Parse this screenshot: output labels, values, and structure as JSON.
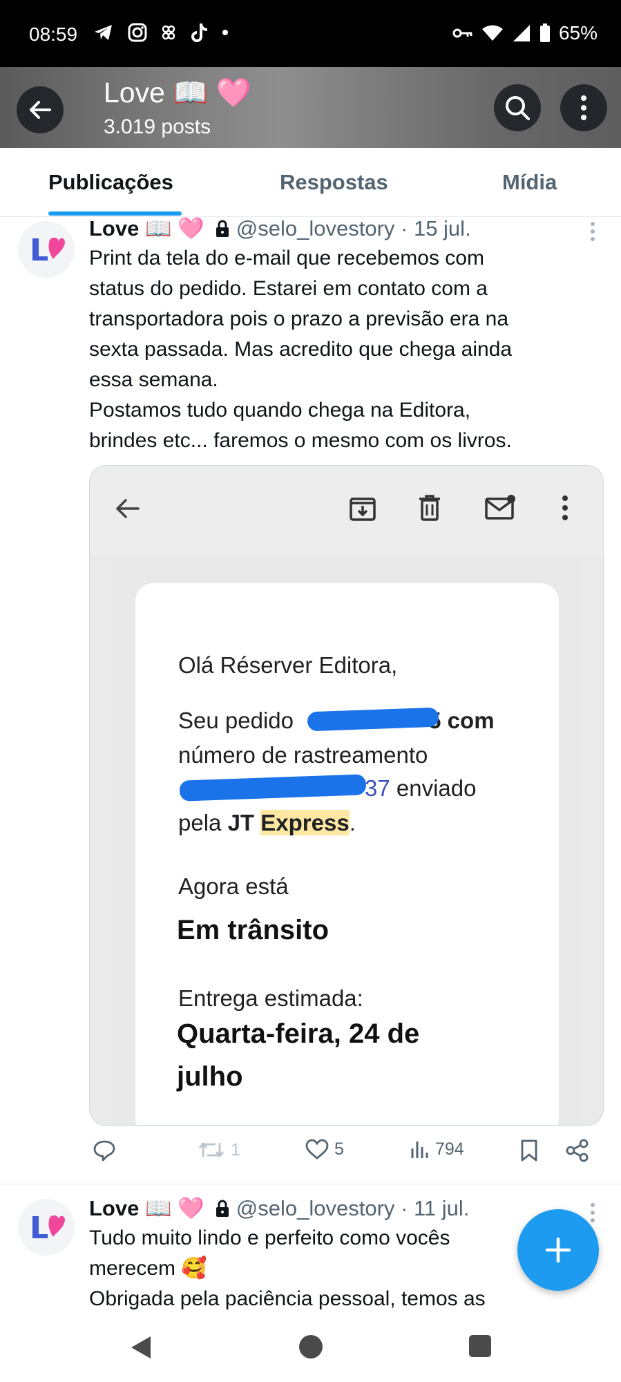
{
  "status_bar": {
    "time": "08:59",
    "battery": "65%",
    "icons_left": [
      "telegram-icon",
      "instagram-icon",
      "link-icon",
      "tiktok-icon",
      "dot-icon"
    ],
    "icons_right": [
      "key-icon",
      "wifi-icon",
      "signal-icon",
      "battery-icon"
    ]
  },
  "header": {
    "title": "Love 📖 🩷",
    "posts_count": "3.019 posts"
  },
  "tabs": [
    {
      "label": "Publicações",
      "active": true
    },
    {
      "label": "Respostas",
      "active": false
    },
    {
      "label": "Mídia",
      "active": false
    }
  ],
  "posts": [
    {
      "author": "Love 📖 🩷",
      "handle_date": "@selo_lovestory · 15 jul.",
      "text_lines": [
        "Print da tela do e-mail que recebemos com",
        "status do pedido. Estarei em contato com a",
        "transportadora pois o prazo a previsão era na",
        "sexta passada. Mas acredito que chega ainda",
        "essa semana.",
        "Postamos tudo quando chega na Editora,",
        "brindes etc... faremos o mesmo com os livros."
      ],
      "media": {
        "greeting": "Olá Réserver Editora,",
        "line1_a": "Seu pedido",
        "line1_b": "5 com",
        "line2": "número de rastreamento",
        "line3_a": "37",
        "line3_b": "enviado",
        "line4_a": "pela",
        "line4_b": "JT",
        "line4_c": "Express",
        "line4_d": ".",
        "status_label": "Agora está",
        "status_value": "Em trânsito",
        "delivery_label": "Entrega estimada:",
        "delivery_line1": "Quarta-feira, 24 de",
        "delivery_line2": "julho"
      },
      "actions": {
        "retweets": "1",
        "likes": "5",
        "views": "794"
      }
    },
    {
      "author": "Love 📖 🩷",
      "handle_date": "@selo_lovestory · 11 jul.",
      "text_lines": [
        "Tudo muito lindo e perfeito como vocês",
        "merecem 🥰",
        "Obrigada pela paciência pessoal, temos as"
      ]
    }
  ],
  "colors": {
    "accent": "#1d9bf0",
    "text_primary": "#0f1419",
    "text_secondary": "#536471",
    "highlight": "#fde7a3"
  }
}
